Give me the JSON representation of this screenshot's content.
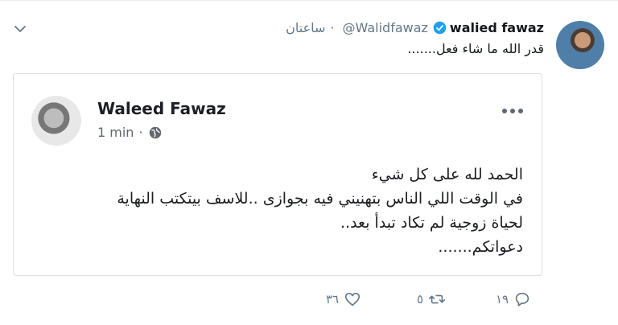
{
  "tweet": {
    "display_name": "walied fawaz",
    "handle": "@Walidfawaz",
    "separator": "·",
    "time": "ساعتان",
    "text": "قدر الله ما شاء فعل.......",
    "icons": {
      "avatar": "avatar",
      "verified": "verified-badge-icon",
      "menu": "chevron-down-icon"
    },
    "actions": {
      "reply_count": "١٩",
      "retweet_count": "٥",
      "like_count": "٣٦"
    }
  },
  "embedded_post": {
    "author": "Waleed Fawaz",
    "time": "1 min",
    "separator": "·",
    "icons": {
      "privacy": "globe-icon",
      "more": "more-dots-icon"
    },
    "lines": [
      "الحمد لله على كل شيء",
      "في الوقت اللي الناس بتهنيني فيه بجوازى ..للاسف بيتكتب النهاية",
      "لحياة زوجية لم تكاد تبدأ بعد..",
      "دعواتكم......."
    ]
  },
  "colors": {
    "text": "#14171a",
    "muted": "#657786",
    "verified": "#1da1f2",
    "card_border": "#dddfe2"
  }
}
